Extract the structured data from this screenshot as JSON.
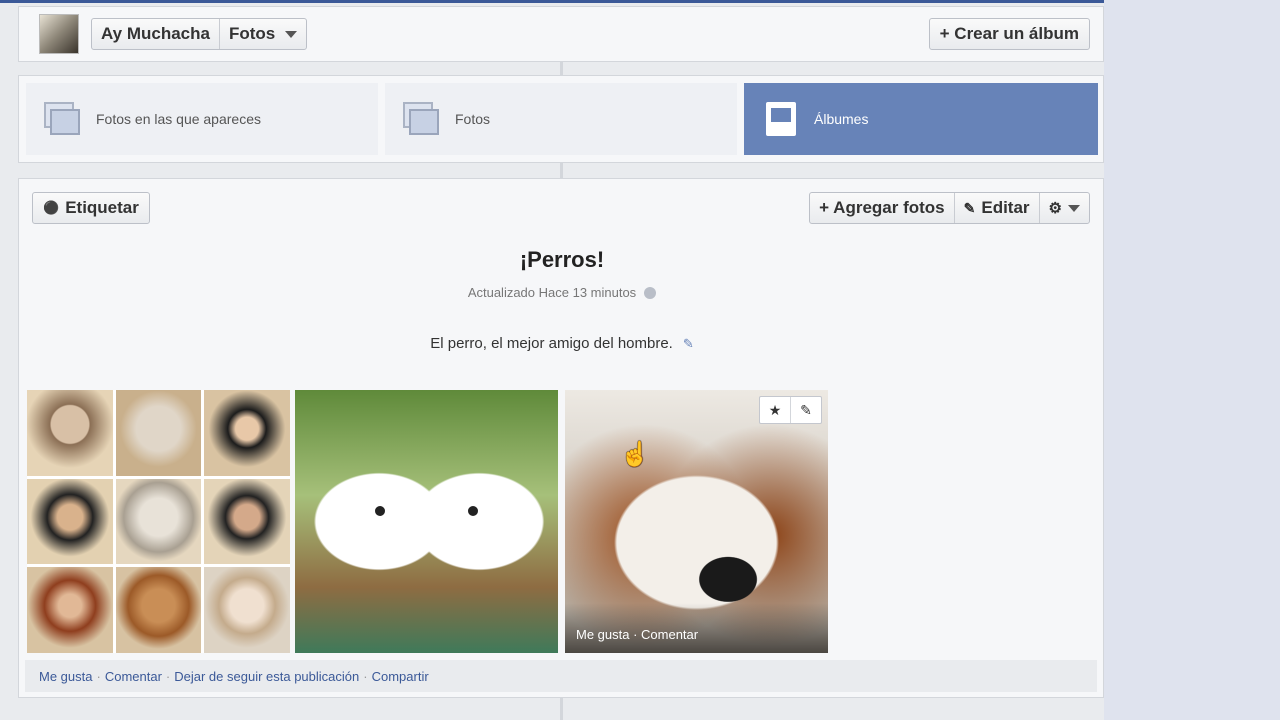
{
  "header": {
    "profile_name": "Ay Muchacha",
    "section_label": "Fotos",
    "create_album": "+ Crear un álbum"
  },
  "tabs": [
    {
      "label": "Fotos en las que apareces"
    },
    {
      "label": "Fotos"
    },
    {
      "label": "Álbumes",
      "active": true
    }
  ],
  "album": {
    "tag_button": "Etiquetar",
    "add_photos": "+ Agregar fotos",
    "edit": "Editar",
    "title": "¡Perros!",
    "updated": "Actualizado Hace 13 minutos",
    "description": "El perro, el mejor amigo del hombre.",
    "photo_actions": "Me gusta · Comentar"
  },
  "footer": {
    "like": "Me gusta",
    "comment": "Comentar",
    "unfollow": "Dejar de seguir esta publicación",
    "share": "Compartir"
  },
  "colors": {
    "accent": "#6783b8",
    "link": "#3b5998"
  }
}
